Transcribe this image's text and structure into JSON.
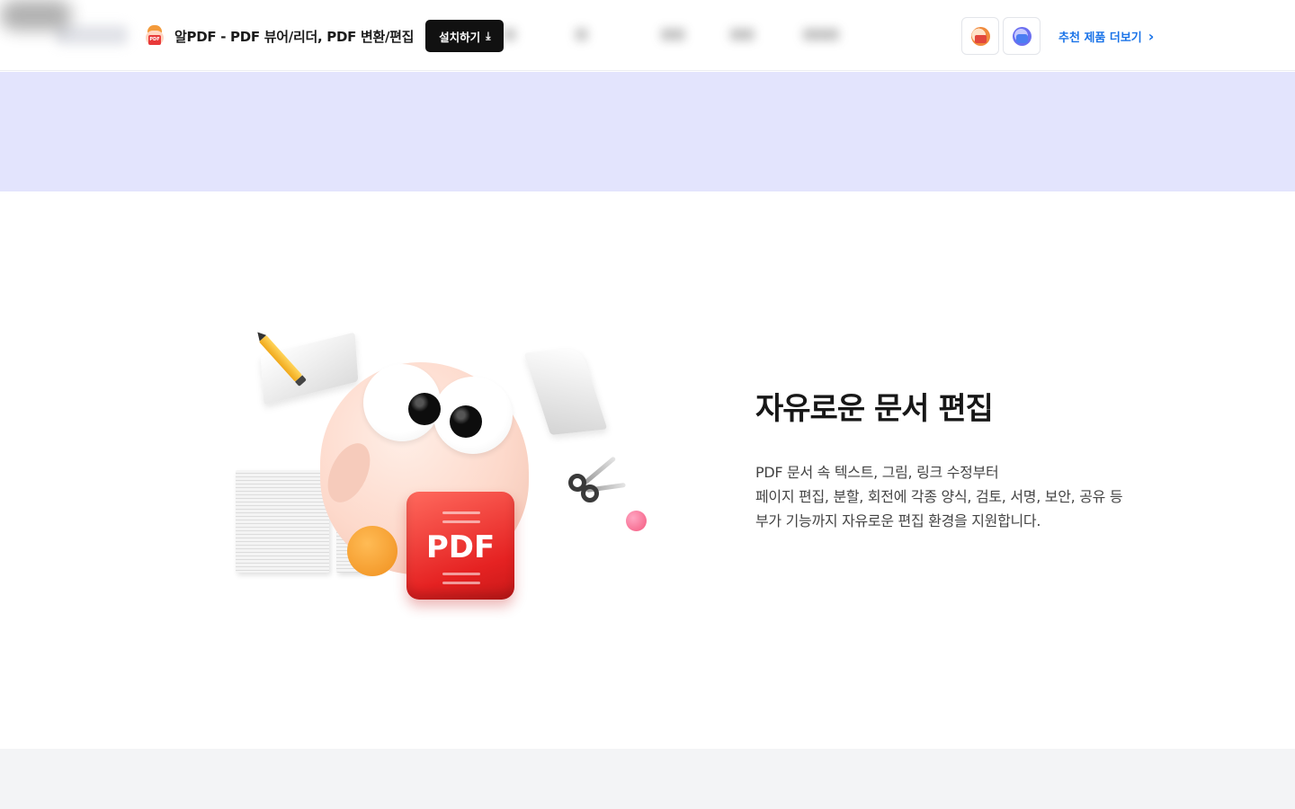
{
  "promo": {
    "app_name": "알PDF - PDF 뷰어/리더, PDF 변환/편집",
    "install_label": "설치하기",
    "more_link": "추천 제품 더보기"
  },
  "feature": {
    "title": "자유로운 문서 편집",
    "description": [
      "PDF 문서 속 텍스트, 그림, 링크 수정부터",
      "페이지 편집, 분할, 회전에 각종 양식, 검토, 서명, 보안, 공유 등",
      "부가 기능까지 자유로운 편집 환경을 지원합니다."
    ],
    "illustration": {
      "badge_text": "PDF"
    }
  },
  "icons": {
    "download": "download-icon",
    "chevron": "chevron-right-icon"
  },
  "colors": {
    "banner": "#e3e4fd",
    "link": "#1a73e8",
    "install_button": "#111111",
    "pdf_red": "#e52222",
    "bottom_band": "#f3f4f6"
  }
}
